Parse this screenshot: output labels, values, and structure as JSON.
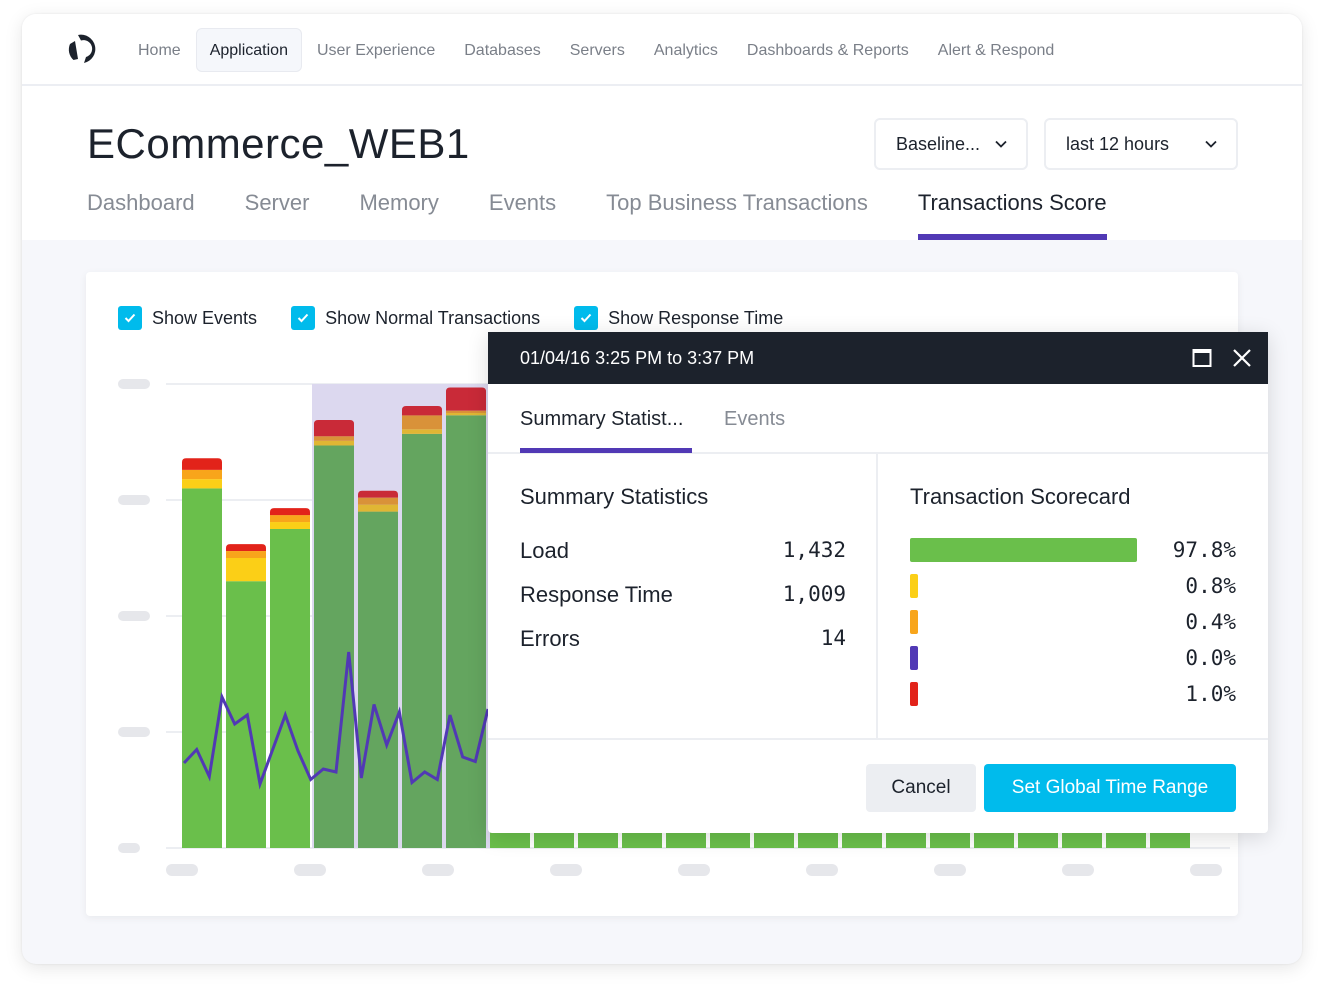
{
  "nav": {
    "items": [
      {
        "label": "Home",
        "active": false
      },
      {
        "label": "Application",
        "active": true
      },
      {
        "label": "User Experience",
        "active": false
      },
      {
        "label": "Databases",
        "active": false
      },
      {
        "label": "Servers",
        "active": false
      },
      {
        "label": "Analytics",
        "active": false
      },
      {
        "label": "Dashboards & Reports",
        "active": false
      },
      {
        "label": "Alert & Respond",
        "active": false
      }
    ]
  },
  "header": {
    "title": "ECommerce_WEB1",
    "baseline_dropdown": "Baseline...",
    "range_dropdown": "last 12 hours",
    "tabs": [
      {
        "label": "Dashboard",
        "active": false
      },
      {
        "label": "Server",
        "active": false
      },
      {
        "label": "Memory",
        "active": false
      },
      {
        "label": "Events",
        "active": false
      },
      {
        "label": "Top Business Transactions",
        "active": false
      },
      {
        "label": "Transactions Score",
        "active": true
      }
    ]
  },
  "filters": [
    {
      "label": "Show Events",
      "checked": true
    },
    {
      "label": "Show Normal Transactions",
      "checked": true
    },
    {
      "label": "Show Response Time",
      "checked": true
    }
  ],
  "colors": {
    "accent": "#5139b5",
    "primary_button": "#00bbec",
    "normal": "#6abf4b",
    "slow": "#fbcf17",
    "very_slow": "#f8a51b",
    "stall": "#5139b5",
    "error": "#e2231a",
    "selection": "#dcd8ef"
  },
  "chart_data": {
    "type": "bar",
    "stacked": true,
    "series_order": [
      "normal",
      "slow",
      "very_slow",
      "error"
    ],
    "bars": [
      {
        "normal": 310,
        "slow": 8,
        "very_slow": 8,
        "error": 10,
        "selected": false
      },
      {
        "normal": 230,
        "slow": 20,
        "very_slow": 6,
        "error": 6,
        "selected": false
      },
      {
        "normal": 275,
        "slow": 6,
        "very_slow": 6,
        "error": 6,
        "selected": false
      },
      {
        "normal": 347,
        "slow": 4,
        "very_slow": 4,
        "error": 14,
        "selected": true
      },
      {
        "normal": 290,
        "slow": 6,
        "very_slow": 6,
        "error": 6,
        "selected": true
      },
      {
        "normal": 357,
        "slow": 4,
        "very_slow": 12,
        "error": 8,
        "selected": true
      },
      {
        "normal": 373,
        "slow": 2,
        "very_slow": 2,
        "error": 20,
        "selected": true
      },
      {
        "normal": 15
      },
      {
        "normal": 15
      },
      {
        "normal": 15
      },
      {
        "normal": 15
      },
      {
        "normal": 15
      },
      {
        "normal": 15
      },
      {
        "normal": 15
      },
      {
        "normal": 15
      },
      {
        "normal": 15
      },
      {
        "normal": 15
      },
      {
        "normal": 15
      },
      {
        "normal": 15
      },
      {
        "normal": 15
      },
      {
        "normal": 15
      },
      {
        "normal": 15
      },
      {
        "normal": 15
      }
    ],
    "response_time_line": [
      26,
      35,
      17,
      70,
      52,
      58,
      12,
      35,
      58,
      34,
      15,
      22,
      20,
      100,
      16,
      65,
      38,
      60,
      13,
      20,
      15,
      58,
      30,
      27,
      62
    ],
    "ylim": [
      0,
      400
    ],
    "y_tick_labels": [
      "",
      "",
      "",
      "",
      ""
    ],
    "x_tick_labels": [
      "",
      "",
      "",
      "",
      "",
      "",
      "",
      "",
      ""
    ],
    "grid": true
  },
  "popup": {
    "title": "01/04/16 3:25 PM to 3:37 PM",
    "tabs": [
      {
        "label": "Summary Statist...",
        "active": true
      },
      {
        "label": "Events",
        "active": false
      }
    ],
    "summary": {
      "title": "Summary Statistics",
      "rows": [
        {
          "label": "Load",
          "value": "1,432"
        },
        {
          "label": "Response Time",
          "value": "1,009"
        },
        {
          "label": "Errors",
          "value": "14"
        }
      ]
    },
    "scorecard": {
      "title": "Transaction Scorecard",
      "rows": [
        {
          "category": "normal",
          "percent": 97.8,
          "label": "97.8%",
          "color": "#6abf4b"
        },
        {
          "category": "slow",
          "percent": 0.8,
          "label": "0.8%",
          "color": "#fbcf17"
        },
        {
          "category": "very_slow",
          "percent": 0.4,
          "label": "0.4%",
          "color": "#f8a51b"
        },
        {
          "category": "stall",
          "percent": 0.0,
          "label": "0.0%",
          "color": "#5139b5"
        },
        {
          "category": "error",
          "percent": 1.0,
          "label": "1.0%",
          "color": "#e2231a"
        }
      ]
    },
    "cancel_label": "Cancel",
    "set_range_label": "Set Global Time Range"
  }
}
